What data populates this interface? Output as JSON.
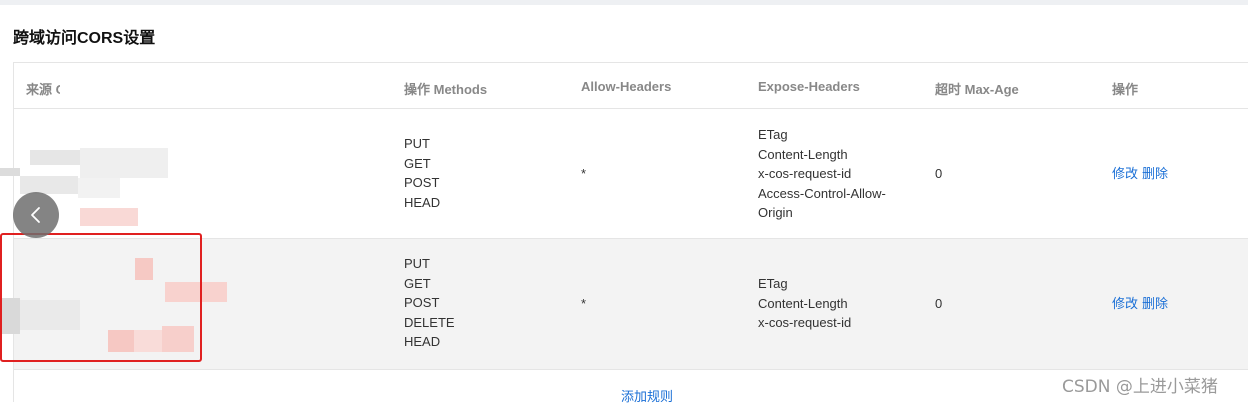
{
  "page": {
    "title": "跨域访问CORS设置"
  },
  "table": {
    "headers": {
      "origin": "来源 Origin",
      "methods": "操作 Methods",
      "allow_headers": "Allow-Headers",
      "expose_headers": "Expose-Headers",
      "max_age": "超时 Max-Age",
      "actions": "操作"
    },
    "rows": [
      {
        "methods": [
          "PUT",
          "GET",
          "POST",
          "HEAD"
        ],
        "allow_headers": "*",
        "expose_headers": [
          "ETag",
          "Content-Length",
          "x-cos-request-id",
          "Access-Control-Allow-",
          "Origin"
        ],
        "max_age": "0",
        "edit": "修改",
        "delete": "删除"
      },
      {
        "methods": [
          "PUT",
          "GET",
          "POST",
          "DELETE",
          "HEAD"
        ],
        "allow_headers": "*",
        "expose_headers": [
          "ETag",
          "Content-Length",
          "x-cos-request-id"
        ],
        "max_age": "0",
        "edit": "修改",
        "delete": "删除"
      }
    ],
    "add_rule": "添加规则"
  },
  "watermark": "CSDN @上进小菜猪",
  "colors": {
    "link": "#1a6fd6",
    "highlight_border": "#e02020"
  },
  "icons": {
    "carousel_prev": "chevron-left-icon"
  }
}
